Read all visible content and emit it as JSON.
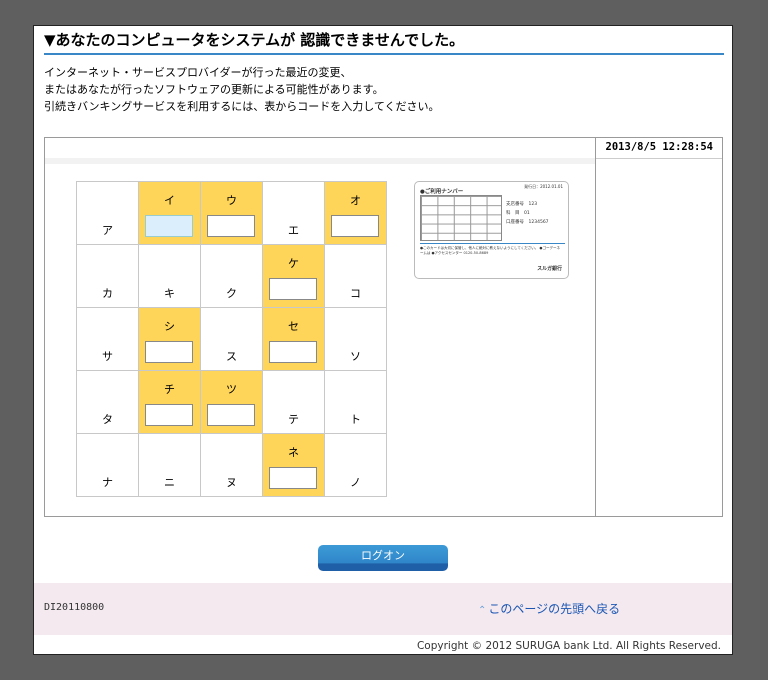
{
  "page": {
    "title": "▼あなたのコンピュータをシステムが 認識できませんでした。",
    "message": [
      "インターネット・サービスプロバイダーが行った最近の変更、",
      "またはあなたが行ったソフトウェアの更新による可能性があります。",
      "引続きバンキングサービスを利用するには、表からコードを入力してください。"
    ],
    "datetime": "2013/8/5  12:28:54"
  },
  "grid": {
    "rows": [
      [
        {
          "label": "ア",
          "input": false
        },
        {
          "label": "イ",
          "input": true,
          "active": true
        },
        {
          "label": "ウ",
          "input": true
        },
        {
          "label": "エ",
          "input": false
        },
        {
          "label": "オ",
          "input": true
        }
      ],
      [
        {
          "label": "カ",
          "input": false
        },
        {
          "label": "キ",
          "input": false
        },
        {
          "label": "ク",
          "input": false
        },
        {
          "label": "ケ",
          "input": true
        },
        {
          "label": "コ",
          "input": false
        }
      ],
      [
        {
          "label": "サ",
          "input": false
        },
        {
          "label": "シ",
          "input": true
        },
        {
          "label": "ス",
          "input": false
        },
        {
          "label": "セ",
          "input": true
        },
        {
          "label": "ソ",
          "input": false
        }
      ],
      [
        {
          "label": "タ",
          "input": false
        },
        {
          "label": "チ",
          "input": true
        },
        {
          "label": "ツ",
          "input": true
        },
        {
          "label": "テ",
          "input": false
        },
        {
          "label": "ト",
          "input": false
        }
      ],
      [
        {
          "label": "ナ",
          "input": false
        },
        {
          "label": "ニ",
          "input": false
        },
        {
          "label": "ヌ",
          "input": false
        },
        {
          "label": "ネ",
          "input": true
        },
        {
          "label": "ノ",
          "input": false
        }
      ]
    ]
  },
  "card": {
    "heading": "●ご利用ナンバー",
    "date": "発行日：2012.01.01",
    "info": [
      "支店番号　123",
      "科　目　01",
      "口座番号　1234567"
    ],
    "note": "●このカードは大切に保管し、他人に絶対に教えないようにしてください。 ●ゴーデーネームは ●アクセスセンター 0120-50-8689",
    "bank": "スルガ銀行"
  },
  "actions": {
    "login_label": "ログオン"
  },
  "footer": {
    "code": "DI20110800",
    "top_link": "このページの先頭へ戻る",
    "copyright": "Copyright © 2012 SURUGA bank Ltd. All Rights Reserved."
  }
}
